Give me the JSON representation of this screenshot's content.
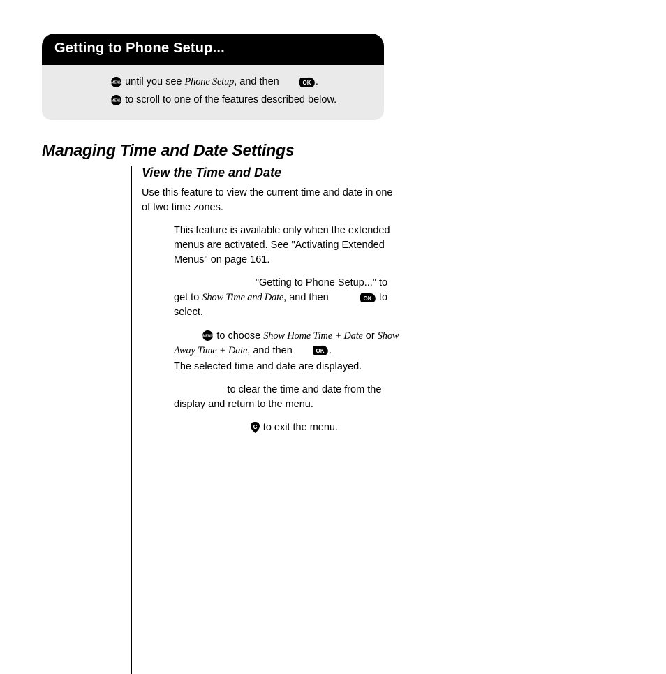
{
  "callout": {
    "title": "Getting to Phone Setup...",
    "line1_a": " until you see ",
    "line1_phone": "Phone Setup",
    "line1_b": ", and then ",
    "line1_c": ".",
    "line2": " to scroll to one of the features described below."
  },
  "section": "Managing Time and Date Settings",
  "subsection": "View the Time and Date",
  "body": {
    "p1": "Use this feature to view the current time and date in one of two time zones.",
    "p2": "This feature is available only when the extended menus are activated. See \"Activating Extended Menus\" on page 161.",
    "s1_a": "\"Getting to Phone Setup...\" to get to ",
    "s1_phone": "Show Time and Date",
    "s1_b": ", and then ",
    "s1_c": " to select.",
    "s2_a": " to choose ",
    "s2_phone1": "Show Home Time + Date",
    "s2_mid": " or ",
    "s2_phone2": "Show Away Time + Date",
    "s2_b": ", and then ",
    "s2_c": ".",
    "s2_d": "The selected time and date are displayed.",
    "s3": " to clear the time and date from the display and return to the menu.",
    "s4": " to exit the menu."
  }
}
